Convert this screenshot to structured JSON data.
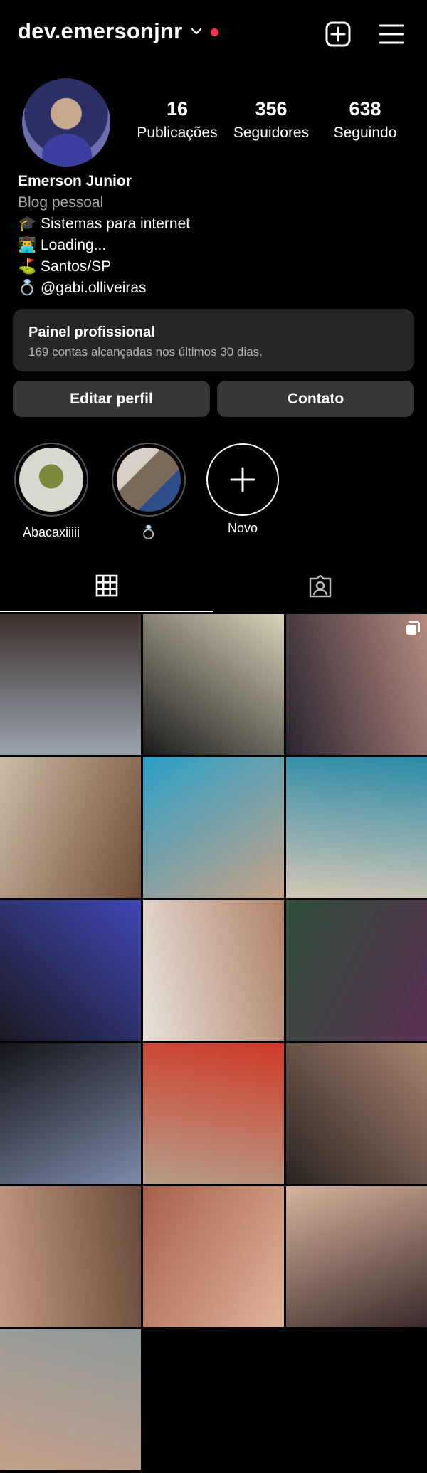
{
  "header": {
    "username": "dev.emersonjnr"
  },
  "profile": {
    "stats": [
      {
        "value": "16",
        "label": "Publicações"
      },
      {
        "value": "356",
        "label": "Seguidores"
      },
      {
        "value": "638",
        "label": "Seguindo"
      }
    ],
    "name": "Emerson Junior",
    "category": "Blog pessoal",
    "bio_lines": [
      "🎓 Sistemas para internet",
      "👨‍💻 Loading...",
      "⛳ Santos/SP",
      "💍 @gabi.olliveiras"
    ]
  },
  "professional_panel": {
    "title": "Painel profissional",
    "subtitle": "169 contas alcançadas nos últimos 30 dias."
  },
  "buttons": {
    "edit": "Editar perfil",
    "contact": "Contato"
  },
  "highlights": [
    {
      "label": "Abacaxiiiii"
    },
    {
      "label": "💍"
    },
    {
      "label": "Novo"
    }
  ],
  "tabs": [
    {
      "icon": "grid-icon",
      "active": true
    },
    {
      "icon": "tagged-icon",
      "active": false
    }
  ],
  "posts": [
    {
      "colors": [
        "#9aa3b0",
        "#3d2f2a"
      ],
      "multi": false
    },
    {
      "colors": [
        "#1a1a1a",
        "#d9d2b8"
      ],
      "multi": false
    },
    {
      "colors": [
        "#2a2430",
        "#b58a7e"
      ],
      "multi": true
    },
    {
      "colors": [
        "#cdbba5",
        "#6e4e3a"
      ],
      "multi": false
    },
    {
      "colors": [
        "#2a9fc7",
        "#c7a287"
      ],
      "multi": false
    },
    {
      "colors": [
        "#d4c6b5",
        "#2a8ba8"
      ],
      "multi": false
    },
    {
      "colors": [
        "#1c1a22",
        "#3f47b5"
      ],
      "multi": false
    },
    {
      "colors": [
        "#e8e2da",
        "#b08268"
      ],
      "multi": false
    },
    {
      "colors": [
        "#2f4f3a",
        "#5a2f52"
      ],
      "multi": false
    },
    {
      "colors": [
        "#15151a",
        "#7d8aa8"
      ],
      "multi": false
    },
    {
      "colors": [
        "#b59d86",
        "#d13a2a"
      ],
      "multi": false
    },
    {
      "colors": [
        "#2a2320",
        "#a88470"
      ],
      "multi": false
    },
    {
      "colors": [
        "#c49a82",
        "#6b4a3a"
      ],
      "multi": false
    },
    {
      "colors": [
        "#a8604a",
        "#e0b49a"
      ],
      "multi": false
    },
    {
      "colors": [
        "#d7b39c",
        "#3a2a2a"
      ],
      "multi": false
    },
    {
      "colors": [
        "#c4a08a",
        "#8f9a9a"
      ],
      "multi": false
    }
  ]
}
